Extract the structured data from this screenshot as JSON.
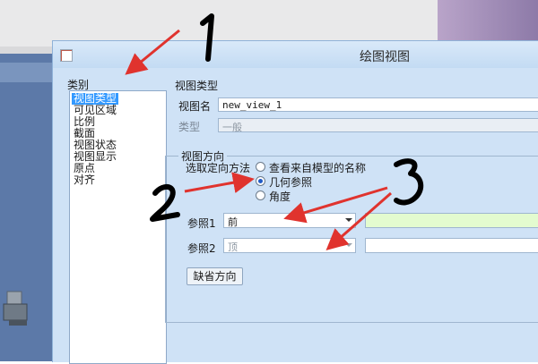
{
  "window": {
    "title": "绘图视图"
  },
  "category": {
    "label": "类别",
    "items": [
      "视图类型",
      "可见区域",
      "比例",
      "截面",
      "视图状态",
      "视图显示",
      "原点",
      "对齐"
    ],
    "selected_index": 0
  },
  "view_type": {
    "section_label": "视图类型",
    "name_label": "视图名",
    "name_value": "new_view_1",
    "type_label": "类型",
    "type_value": "一般"
  },
  "orientation": {
    "group_label": "视图方向",
    "method_label": "选取定向方法",
    "options": [
      "查看来自模型的名称",
      "几何参照",
      "角度"
    ],
    "selected_index": 1,
    "ref1_label": "参照1",
    "ref1_value": "前",
    "ref2_label": "参照2",
    "ref2_value": "顶",
    "default_button": "缺省方向"
  },
  "annotations": {
    "numbers": [
      "1",
      "2",
      "3"
    ],
    "arrow_color": "#e0332e"
  },
  "colors": {
    "dialog_bg": "#cfe2f6",
    "selection": "#3399ff",
    "ref1_field_bg": "#e3fbcf"
  }
}
